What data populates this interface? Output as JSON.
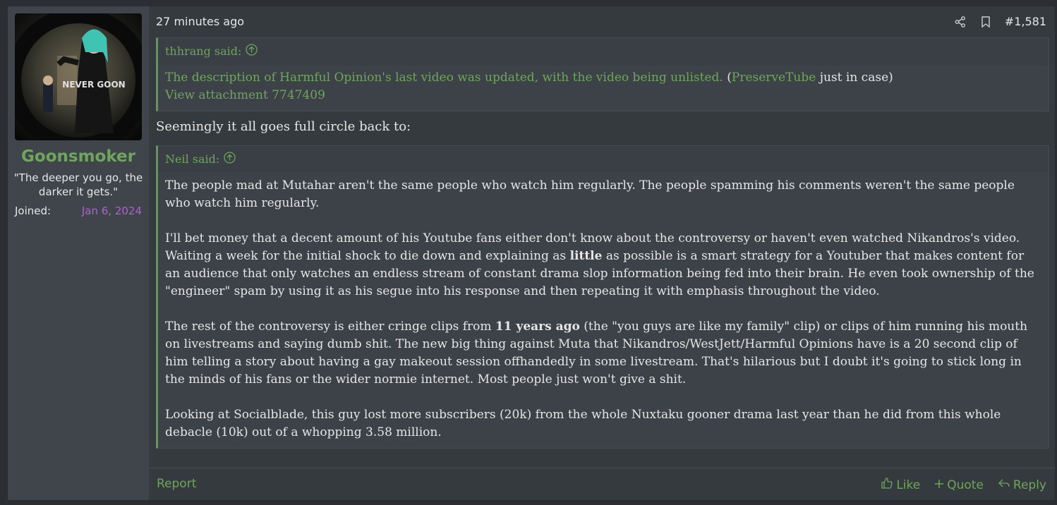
{
  "user": {
    "username": "Goonsmoker",
    "title": "\"The deeper you go, the darker it gets.\"",
    "joined_label": "Joined:",
    "joined_date": "Jan 6, 2024",
    "avatar_shirt_text": "NEVER GOON"
  },
  "post": {
    "time": "27 minutes ago",
    "number": "#1,581",
    "icons": [
      "share-icon",
      "bookmark-icon"
    ]
  },
  "quote1": {
    "author": "thhrang said:",
    "text_green": "The description of Harmful Opinion's last video was updated, with the video being unlisted.",
    "paren_open": " (",
    "link": "PreserveTube",
    "after_link": " just in case)",
    "attachment": "View attachment 7747409"
  },
  "body_line": "Seemingly it all goes full circle back to:",
  "quote2": {
    "author": "Neil said:",
    "p1": "The people mad at Mutahar aren't the same people who watch him regularly. The people spamming his comments weren't the same people who watch him regularly.",
    "p2_a": "I'll bet money that a decent amount of his Youtube fans either don't know about the controversy or haven't even watched Nikandros's video. Waiting a week for the initial shock to die down and explaining as ",
    "p2_bold": "little",
    "p2_b": " as possible is a smart strategy for a Youtuber that makes content for an audience that only watches an endless stream of constant drama slop information being fed into their brain. He even took ownership of the \"engineer\" spam by using it as his segue into his response and then repeating it with emphasis throughout the video.",
    "p3_a": "The rest of the controversy is either cringe clips from ",
    "p3_bold": "11 years ago",
    "p3_b": " (the \"you guys are like my family\" clip) or clips of him running his mouth on livestreams and saying dumb shit. The new big thing against Muta that Nikandros/WestJett/Harmful Opinions have is a 20 second clip of him telling a story about having a gay makeout session offhandedly in some livestream. That's hilarious but I doubt it's going to stick long in the minds of his fans or the wider normie internet. Most people just won't give a shit.",
    "p4": "Looking at Socialblade, this guy lost more subscribers (20k) from the whole Nuxtaku gooner drama last year than he did from this whole debacle (10k) out of a whopping 3.58 million."
  },
  "footer": {
    "report": "Report",
    "like": "Like",
    "quote": "Quote",
    "reply": "Reply"
  },
  "colors": {
    "accent_green": "#6fa55c",
    "date_purple": "#b05fd6",
    "panel": "#353a3f",
    "sidebar": "#3f454a"
  }
}
